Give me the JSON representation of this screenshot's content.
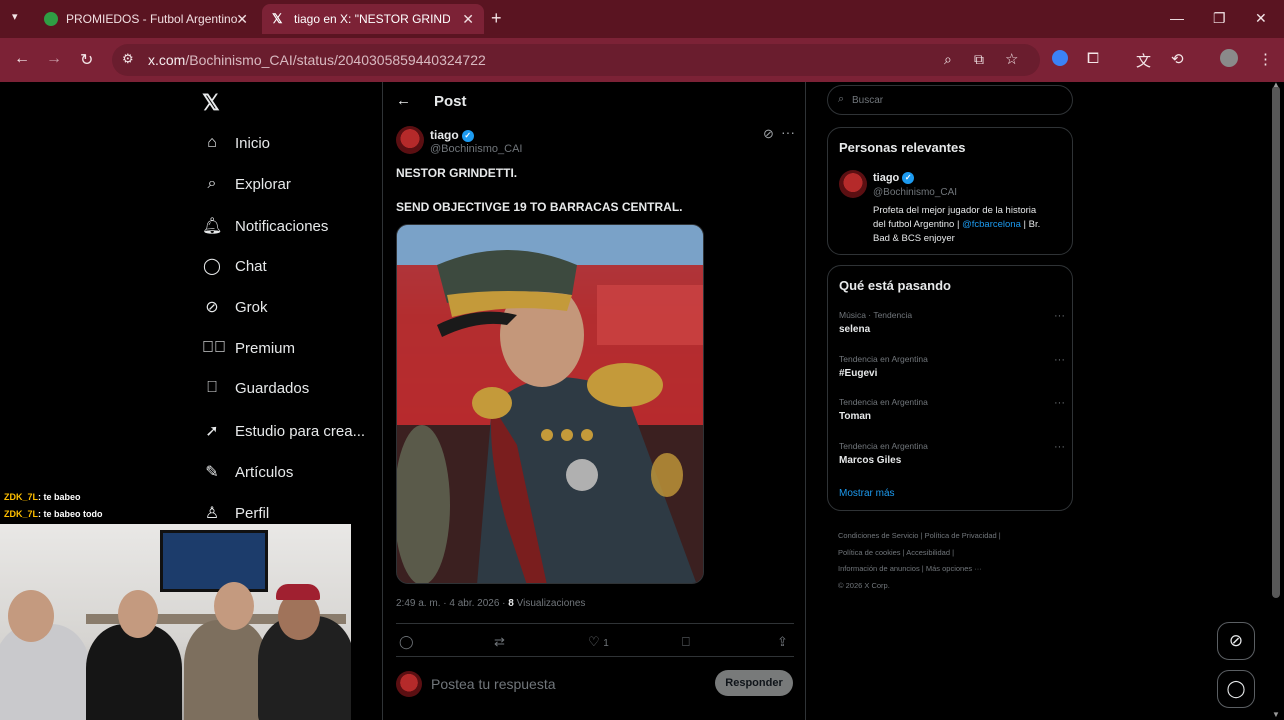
{
  "browser": {
    "tabs": [
      {
        "title": "PROMIEDOS - Futbol Argentino",
        "active": false
      },
      {
        "title": "tiago en X: \"NESTOR GRINDETTI.",
        "active": true
      }
    ],
    "url_host": "x.com",
    "url_path": "/Bochinismo_CAI/status/2040305859440324722"
  },
  "nav": {
    "items": [
      {
        "label": "Inicio",
        "icon": "home-icon"
      },
      {
        "label": "Explorar",
        "icon": "search-icon"
      },
      {
        "label": "Notificaciones",
        "icon": "bell-icon"
      },
      {
        "label": "Chat",
        "icon": "chat-icon"
      },
      {
        "label": "Grok",
        "icon": "grok-icon"
      },
      {
        "label": "Premium",
        "icon": "premium-icon"
      },
      {
        "label": "Guardados",
        "icon": "bookmark-icon"
      },
      {
        "label": "Estudio para crea...",
        "icon": "rocket-icon"
      },
      {
        "label": "Artículos",
        "icon": "article-icon"
      },
      {
        "label": "Perfil",
        "icon": "profile-icon"
      }
    ]
  },
  "post": {
    "header_title": "Post",
    "author_name": "tiago",
    "author_handle": "@Bochinismo_CAI",
    "line1": "NESTOR GRINDETTI.",
    "line2": "SEND OBJECTIVGE 19 TO BARRACAS CENTRAL.",
    "timestamp": "2:49 a. m. · 4 abr. 2026 ·",
    "views_count": "8",
    "views_label": "Visualizaciones",
    "likes": "1",
    "reply_placeholder": "Postea tu respuesta",
    "reply_button": "Responder"
  },
  "sidebar": {
    "search_placeholder": "Buscar",
    "relevant_title": "Personas relevantes",
    "relevant_name": "tiago",
    "relevant_handle": "@Bochinismo_CAI",
    "bio_1": "Profeta del mejor jugador de la historia",
    "bio_2": "del futbol Argentino |",
    "bio_mention": "@fcbarcelona",
    "bio_3": "| Br.",
    "bio_4": "Bad & BCS enjoyer",
    "trends_title": "Qué está pasando",
    "trends": [
      {
        "context": "Música · Tendencia",
        "name": "selena"
      },
      {
        "context": "Tendencia en Argentina",
        "name": "#Eugevi"
      },
      {
        "context": "Tendencia en Argentina",
        "name": "Toman"
      },
      {
        "context": "Tendencia en Argentina",
        "name": "Marcos Giles"
      }
    ],
    "show_more": "Mostrar más",
    "footer": {
      "l1a": "Condiciones de Servicio",
      "l1b": "Política de Privacidad",
      "l2a": "Política de cookies",
      "l2b": "Accesibilidad",
      "l3a": "Información de anuncios",
      "l3b": "Más opciones ···",
      "copyright": "© 2026 X Corp."
    }
  },
  "stream_chat": [
    {
      "user": "ZDK_7L",
      "msg": ": te babeo"
    },
    {
      "user": "ZDK_7L",
      "msg": ": te babeo todo"
    }
  ],
  "colors": {
    "tabbar": "#5a1421",
    "toolbar": "#7c2236",
    "link": "#1d9bf0",
    "verified": "#1d9bf0"
  }
}
